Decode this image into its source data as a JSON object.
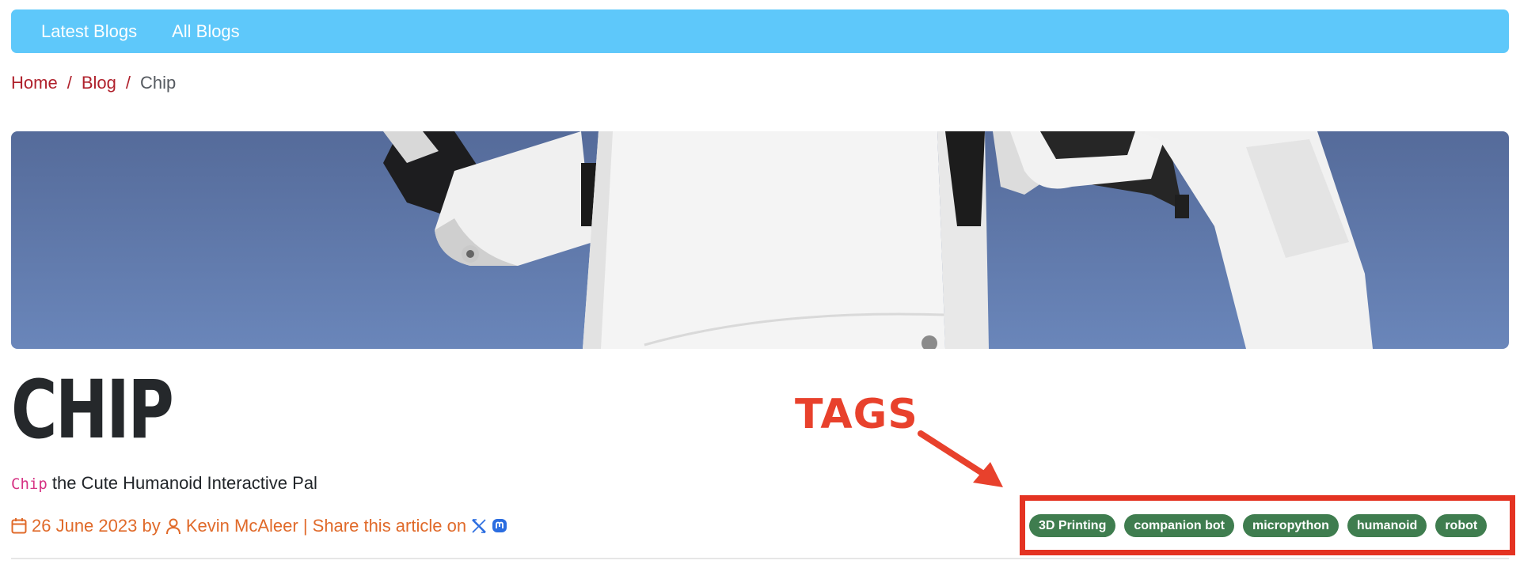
{
  "nav": {
    "items": [
      {
        "label": "Latest Blogs"
      },
      {
        "label": "All Blogs"
      }
    ]
  },
  "breadcrumb": {
    "home": "Home",
    "blog": "Blog",
    "current": "Chip",
    "separator": "/"
  },
  "hero": {
    "alt_icon": "robot-image"
  },
  "article": {
    "title": "CHIP",
    "subtitle_code": "Chip",
    "subtitle_rest": " the Cute Humanoid Interactive Pal",
    "date": "26 June 2023",
    "by": "by",
    "author": "Kevin McAleer",
    "share_text": "| Share this article on",
    "share_icons": [
      "x-icon",
      "mastodon-icon"
    ]
  },
  "annotation": {
    "label": "TAGS"
  },
  "tags": [
    "3D Printing",
    "companion bot",
    "micropython",
    "humanoid",
    "robot"
  ],
  "colors": {
    "navbar": "#5ec8fa",
    "link": "#b0212c",
    "meta": "#e06a2a",
    "tag": "#3f7d4f",
    "annotation": "#e43322",
    "share_icon": "#2b6de0"
  }
}
